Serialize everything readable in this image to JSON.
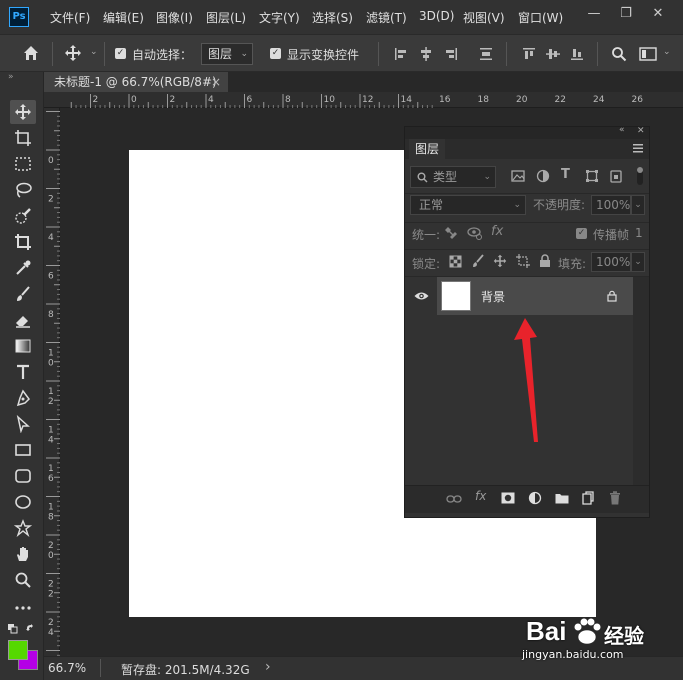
{
  "app": {
    "logo": "Ps"
  },
  "menu": [
    "文件(F)",
    "编辑(E)",
    "图像(I)",
    "图层(L)",
    "文字(Y)",
    "选择(S)",
    "滤镜(T)",
    "3D(D)",
    "视图(V)",
    "窗口(W)"
  ],
  "window_controls": {
    "minimize": "—",
    "restore": "❐",
    "close": "✕"
  },
  "options_bar": {
    "auto_select_label": "自动选择：",
    "auto_select_value": "图层",
    "show_transform_label": "显示变换控件"
  },
  "document_tab": {
    "title": "未标题-1 @ 66.7%(RGB/8#)",
    "close": "×"
  },
  "ruler_top": {
    "labels": [
      "2",
      "0",
      "2",
      "4",
      "6",
      "8",
      "10",
      "12",
      "14",
      "16",
      "18",
      "20",
      "22",
      "24",
      "26"
    ]
  },
  "ruler_left": {
    "labels": [
      "0",
      "2",
      "4",
      "6",
      "8",
      "1 0",
      "1 2",
      "1 4",
      "1 6",
      "1 8",
      "2 0",
      "2 2",
      "2 4"
    ]
  },
  "status": {
    "zoom": "66.7%",
    "scratch": "暂存盘: 201.5M/4.32G",
    "arrow": "›"
  },
  "layers_panel": {
    "tab": "图层",
    "filter_kind": "类型",
    "blend_mode": "正常",
    "opacity_label": "不透明度:",
    "opacity_value": "100%",
    "unify_label": "统一:",
    "propagate_label": "传播帧",
    "propagate_value": "1",
    "lock_label": "锁定:",
    "fill_label": "填充:",
    "fill_value": "100%",
    "layers": [
      {
        "name": "背景",
        "visible": true,
        "locked": true
      }
    ]
  },
  "colors": {
    "foreground": "#55d800",
    "background": "#b400e6",
    "annotation_arrow": "#e8232b"
  },
  "watermark": {
    "brand": "Bai",
    "brand2": "经验",
    "url": "jingyan.baidu.com"
  }
}
